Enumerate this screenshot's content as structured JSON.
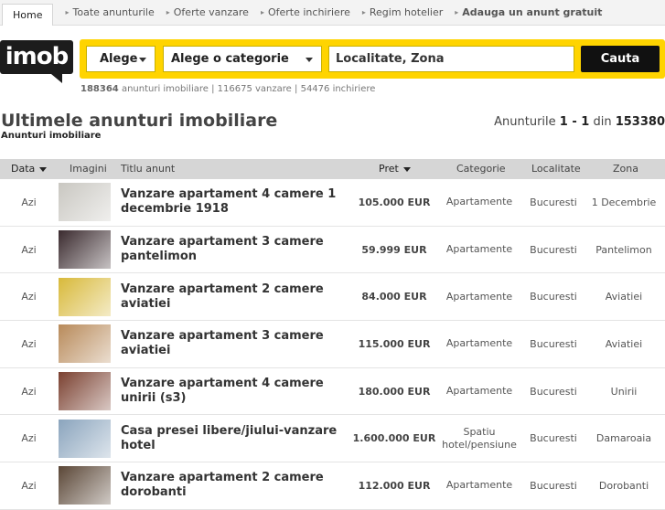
{
  "nav": {
    "home": "Home",
    "items": [
      "Toate anunturile",
      "Oferte vanzare",
      "Oferte inchiriere",
      "Regim hotelier",
      "Adauga un anunt gratuit"
    ]
  },
  "logo": {
    "text": "imob"
  },
  "search": {
    "select1": "Alege",
    "select2": "Alege o categorie",
    "location_placeholder": "Localitate, Zona",
    "button": "Cauta"
  },
  "stats": {
    "total": "188364",
    "total_label": "anunturi imobiliare",
    "separator1": "|",
    "sale": "116675 vanzare",
    "separator2": "|",
    "rent": "54476 inchiriere"
  },
  "heading": {
    "title": "Ultimele anunturi imobiliare",
    "subtitle": "Anunturi imobiliare",
    "counter_prefix": "Anunturile",
    "counter_range": "1 - 1",
    "counter_mid": "din",
    "counter_total": "153380"
  },
  "table": {
    "headers": {
      "date": "Data",
      "images": "Imagini",
      "title": "Titlu anunt",
      "price": "Pret",
      "category": "Categorie",
      "locality": "Localitate",
      "zone": "Zona"
    },
    "rows": [
      {
        "date": "Azi",
        "title": "Vanzare apartament 4 camere 1 decembrie 1918",
        "price": "105.000 EUR",
        "category": "Apartamente",
        "locality": "Bucuresti",
        "zone": "1 Decembrie",
        "thumb": "#c9c7c1"
      },
      {
        "date": "Azi",
        "title": "Vanzare apartament 3 camere pantelimon",
        "price": "59.999 EUR",
        "category": "Apartamente",
        "locality": "Bucuresti",
        "zone": "Pantelimon",
        "thumb": "#3a2a2e"
      },
      {
        "date": "Azi",
        "title": "Vanzare apartament 2 camere aviatiei",
        "price": "84.000 EUR",
        "category": "Apartamente",
        "locality": "Bucuresti",
        "zone": "Aviatiei",
        "thumb": "#d8b93a"
      },
      {
        "date": "Azi",
        "title": "Vanzare apartament 3 camere aviatiei",
        "price": "115.000 EUR",
        "category": "Apartamente",
        "locality": "Bucuresti",
        "zone": "Aviatiei",
        "thumb": "#b88a5a"
      },
      {
        "date": "Azi",
        "title": "Vanzare apartament 4 camere unirii (s3)",
        "price": "180.000 EUR",
        "category": "Apartamente",
        "locality": "Bucuresti",
        "zone": "Unirii",
        "thumb": "#7a4030"
      },
      {
        "date": "Azi",
        "title": "Casa presei libere/jiului-vanzare hotel",
        "price": "1.600.000 EUR",
        "category": "Spatiu hotel/pensiune",
        "locality": "Bucuresti",
        "zone": "Damaroaia",
        "thumb": "#8aa4bd"
      },
      {
        "date": "Azi",
        "title": "Vanzare apartament 2 camere dorobanti",
        "price": "112.000 EUR",
        "category": "Apartamente",
        "locality": "Bucuresti",
        "zone": "Dorobanti",
        "thumb": "#5a4636"
      }
    ]
  }
}
